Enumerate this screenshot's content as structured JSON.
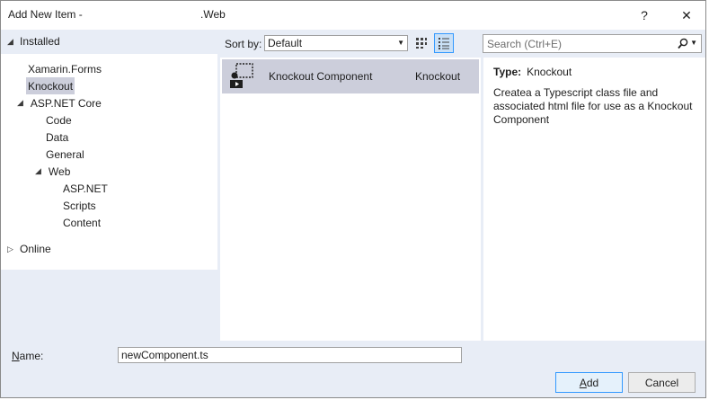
{
  "window": {
    "title": "Add New Item -",
    "title_project": ".Web",
    "help_glyph": "?",
    "close_glyph": "✕"
  },
  "tree": {
    "installed_label": "Installed",
    "online_label": "Online",
    "items": [
      {
        "label": "Xamarin.Forms"
      },
      {
        "label": "Knockout",
        "selected": true
      },
      {
        "label": "ASP.NET Core"
      },
      {
        "label": "Code"
      },
      {
        "label": "Data"
      },
      {
        "label": "General"
      },
      {
        "label": "Web"
      },
      {
        "label": "ASP.NET"
      },
      {
        "label": "Scripts"
      },
      {
        "label": "Content"
      }
    ]
  },
  "sort": {
    "label": "Sort by:",
    "selected": "Default"
  },
  "search": {
    "placeholder": "Search (Ctrl+E)"
  },
  "templates": [
    {
      "name": "Knockout Component",
      "category": "Knockout",
      "icon": "knockout-component-icon"
    }
  ],
  "details": {
    "type_label": "Type:",
    "type_value": "Knockout",
    "description": "Createa a Typescript class file and associated html file for use as a Knockout Component"
  },
  "name_field": {
    "label_first": "N",
    "label_rest": "ame:",
    "value": "newComponent.ts"
  },
  "buttons": {
    "add_first": "A",
    "add_rest": "dd",
    "cancel": "Cancel"
  },
  "colors": {
    "pane_background": "#e8edf6",
    "selection": "#cccedb",
    "accent": "#3399ff"
  }
}
